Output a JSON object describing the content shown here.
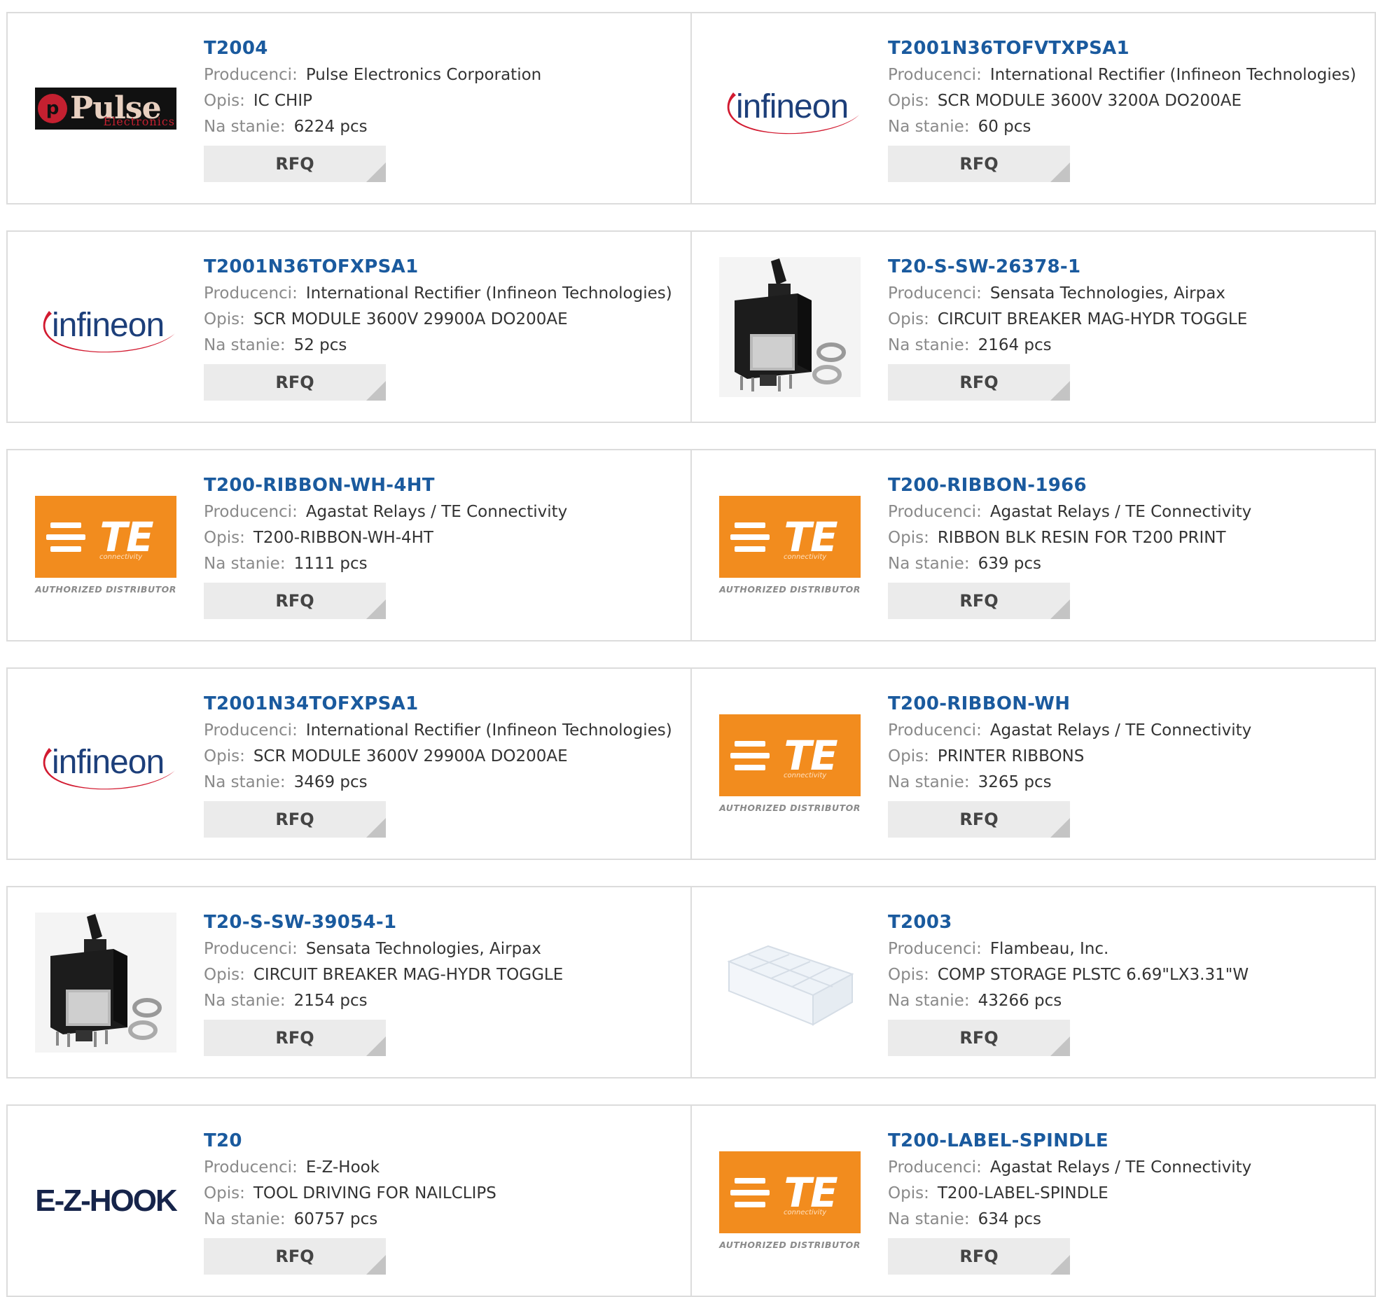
{
  "labels": {
    "manufacturer": "Producenci:",
    "description": "Opis:",
    "stock": "Na stanie:",
    "rfq": "RFQ"
  },
  "products": [
    {
      "part": "T2004",
      "manufacturer": "Pulse Electronics Corporation",
      "description": "IC CHIP",
      "stock": "6224 pcs",
      "logo": "pulse-logo",
      "logo_text": "Pulse",
      "logo_subtext": "Electronics"
    },
    {
      "part": "T2001N36TOFVTXPSA1",
      "manufacturer": "International Rectifier (Infineon Technologies)",
      "description": "SCR MODULE 3600V 3200A DO200AE",
      "stock": "60 pcs",
      "logo": "infineon-logo",
      "logo_text": "infineon"
    },
    {
      "part": "T2001N36TOFXPSA1",
      "manufacturer": "International Rectifier (Infineon Technologies)",
      "description": "SCR MODULE 3600V 29900A DO200AE",
      "stock": "52 pcs",
      "logo": "infineon-logo",
      "logo_text": "infineon"
    },
    {
      "part": "T20-S-SW-26378-1",
      "manufacturer": "Sensata Technologies, Airpax",
      "description": "CIRCUIT BREAKER MAG-HYDR TOGGLE",
      "stock": "2164 pcs",
      "logo": "toggle-breaker-photo"
    },
    {
      "part": "T200-RIBBON-WH-4HT",
      "manufacturer": "Agastat Relays / TE Connectivity",
      "description": "T200-RIBBON-WH-4HT",
      "stock": "1111 pcs",
      "logo": "te-logo",
      "logo_text": "TE",
      "logo_subtext": "connectivity",
      "logo_caption": "AUTHORIZED DISTRIBUTOR"
    },
    {
      "part": "T200-RIBBON-1966",
      "manufacturer": "Agastat Relays / TE Connectivity",
      "description": "RIBBON BLK RESIN FOR T200 PRINT",
      "stock": "639 pcs",
      "logo": "te-logo",
      "logo_text": "TE",
      "logo_subtext": "connectivity",
      "logo_caption": "AUTHORIZED DISTRIBUTOR"
    },
    {
      "part": "T2001N34TOFXPSA1",
      "manufacturer": "International Rectifier (Infineon Technologies)",
      "description": "SCR MODULE 3600V 29900A DO200AE",
      "stock": "3469 pcs",
      "logo": "infineon-logo",
      "logo_text": "infineon"
    },
    {
      "part": "T200-RIBBON-WH",
      "manufacturer": "Agastat Relays / TE Connectivity",
      "description": "PRINTER RIBBONS",
      "stock": "3265 pcs",
      "logo": "te-logo",
      "logo_text": "TE",
      "logo_subtext": "connectivity",
      "logo_caption": "AUTHORIZED DISTRIBUTOR"
    },
    {
      "part": "T20-S-SW-39054-1",
      "manufacturer": "Sensata Technologies, Airpax",
      "description": "CIRCUIT BREAKER MAG-HYDR TOGGLE",
      "stock": "2154 pcs",
      "logo": "toggle-breaker-photo"
    },
    {
      "part": "T2003",
      "manufacturer": "Flambeau, Inc.",
      "description": "COMP STORAGE PLSTC 6.69\"LX3.31\"W",
      "stock": "43266 pcs",
      "logo": "storage-box-photo"
    },
    {
      "part": "T20",
      "manufacturer": "E-Z-Hook",
      "description": "TOOL DRIVING FOR NAILCLIPS",
      "stock": "60757 pcs",
      "logo": "ezhook-logo",
      "logo_text": "E-Z-HOOK"
    },
    {
      "part": "T200-LABEL-SPINDLE",
      "manufacturer": "Agastat Relays / TE Connectivity",
      "description": "T200-LABEL-SPINDLE",
      "stock": "634 pcs",
      "logo": "te-logo",
      "logo_text": "TE",
      "logo_subtext": "connectivity",
      "logo_caption": "AUTHORIZED DISTRIBUTOR"
    }
  ]
}
